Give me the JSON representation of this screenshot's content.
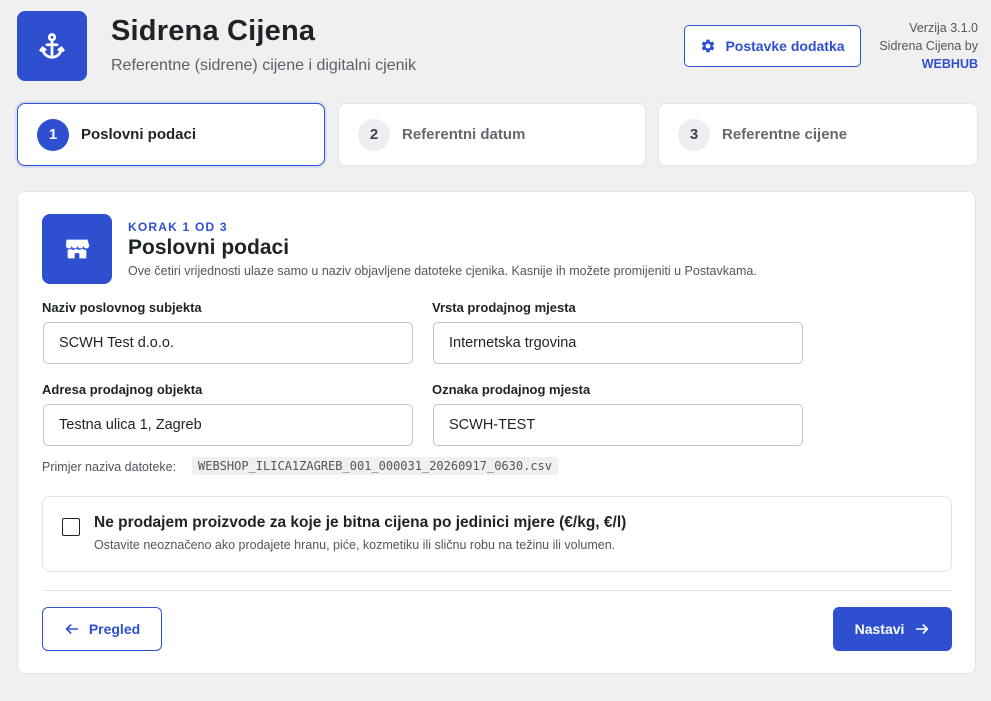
{
  "header": {
    "title": "Sidrena Cijena",
    "subtitle": "Referentne (sidrene) cijene i digitalni cjenik",
    "logo_icon": "anchor-icon",
    "settings_button": "Postavke dodatka",
    "settings_icon": "gear-icon",
    "version": "Verzija 3.1.0",
    "credit": "Sidrena Cijena by",
    "brand": "WEBHUB"
  },
  "steps": [
    {
      "number": "1",
      "label": "Poslovni podaci",
      "active": true
    },
    {
      "number": "2",
      "label": "Referentni datum",
      "active": false
    },
    {
      "number": "3",
      "label": "Referentne cijene",
      "active": false
    }
  ],
  "section": {
    "icon": "store-icon",
    "eyebrow": "KORAK 1 OD 3",
    "title": "Poslovni podaci",
    "description": "Ove četiri vrijednosti ulaze samo u naziv objavljene datoteke cjenika. Kasnije ih možete promijeniti u Postavkama."
  },
  "fields": {
    "business_name": {
      "label": "Naziv poslovnog subjekta",
      "value": "SCWH Test d.o.o."
    },
    "location_type": {
      "label": "Vrsta prodajnog mjesta",
      "value": "Internetska trgovina"
    },
    "address": {
      "label": "Adresa prodajnog objekta",
      "value": "Testna ulica 1, Zagreb"
    },
    "location_code": {
      "label": "Oznaka prodajnog mjesta",
      "value": "SCWH-TEST"
    }
  },
  "example": {
    "label": "Primjer naziva datoteke:",
    "filename": "WEBSHOP_ILICA1ZAGREB_001_000031_20260917_0630.csv"
  },
  "unit_price_option": {
    "checked": false,
    "title": "Ne prodajem proizvode za koje je bitna cijena po jedinici mjere (€/kg, €/l)",
    "description": "Ostavite neoznačeno ako prodajete hranu, piće, kozmetiku ili sličnu robu na težinu ili volumen."
  },
  "footer": {
    "back_label": "Pregled",
    "next_label": "Nastavi"
  },
  "colors": {
    "accent": "#2f4fd1",
    "background": "#f0f0f1",
    "text": "#1d2327"
  }
}
